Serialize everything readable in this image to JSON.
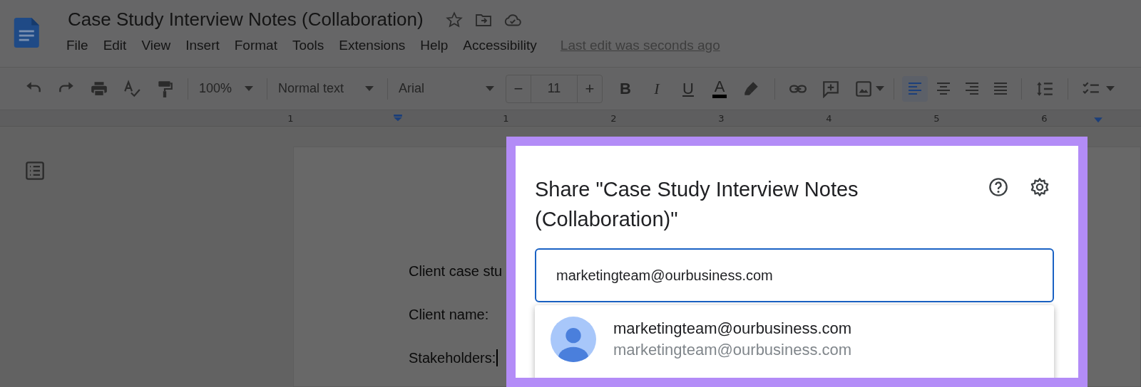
{
  "document": {
    "title": "Case Study Interview Notes (Collaboration)",
    "menu": [
      "File",
      "Edit",
      "View",
      "Insert",
      "Format",
      "Tools",
      "Extensions",
      "Help",
      "Accessibility"
    ],
    "last_edit": "Last edit was seconds ago"
  },
  "toolbar": {
    "zoom": "100%",
    "style": "Normal text",
    "font": "Arial",
    "minus": "−",
    "font_size": "11",
    "plus": "+",
    "format": [
      {
        "kind": "bold",
        "label": "B"
      },
      {
        "kind": "italic",
        "label": "I"
      },
      {
        "kind": "underline",
        "label": "U"
      },
      {
        "kind": "color",
        "label": "A"
      }
    ],
    "align": [
      {
        "kind": "left",
        "selected": true
      },
      {
        "kind": "center",
        "selected": false
      },
      {
        "kind": "right",
        "selected": false
      },
      {
        "kind": "justify",
        "selected": false
      }
    ]
  },
  "ruler": {
    "numbers": [
      "1",
      "1",
      "2",
      "3",
      "4",
      "5",
      "6"
    ]
  },
  "page": {
    "lines": [
      "Client case stu",
      "Client name:",
      "Stakeholders:"
    ]
  },
  "share_dialog": {
    "title": "Share \"Case Study Interview Notes (Collaboration)\"",
    "input_value": "marketingteam@ourbusiness.com",
    "suggestions": [
      {
        "name": "marketingteam@ourbusiness.com",
        "email": "marketingteam@ourbusiness.com"
      }
    ]
  }
}
